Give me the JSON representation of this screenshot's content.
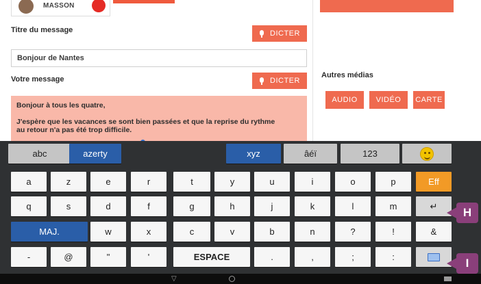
{
  "app": {
    "user_name": "MASSON",
    "title_label": "Titre du message",
    "dictate_label": "DICTER",
    "title_value": "Bonjour de Nantes",
    "message_label": "Votre message",
    "message_lines": [
      "Bonjour à tous les quatre,",
      "J'espère que les vacances se sont bien passées et que la reprise du  rythme\nau retour n'a pas été trop difficile."
    ],
    "right_top_bar": "",
    "media_title": "Autres médias",
    "media_buttons": [
      "AUDIO",
      "VIDÉO",
      "CARTE"
    ]
  },
  "keyboard": {
    "mode_row": [
      "abc",
      "azerty",
      "xyz",
      "âéï",
      "123"
    ],
    "row1": [
      "a",
      "z",
      "e",
      "r",
      "t",
      "y",
      "u",
      "i",
      "o",
      "p",
      "Eff"
    ],
    "row2": [
      "q",
      "s",
      "d",
      "f",
      "g",
      "h",
      "j",
      "k",
      "l",
      "m",
      "↵"
    ],
    "row3": [
      "MAJ.",
      "w",
      "x",
      "c",
      "v",
      "b",
      "n",
      "?",
      "!",
      "&"
    ],
    "row4": [
      "-",
      "@",
      "\"",
      "'",
      "ESPACE",
      ".",
      ",",
      ";",
      ":"
    ]
  },
  "callouts": {
    "enter_marker": "H",
    "keyboard_marker": "I"
  },
  "icons": {
    "mic": "microphone-icon",
    "emoji": "smiley-icon",
    "hide_keyboard": "keyboard-icon",
    "nav_back": "triangle-back-icon",
    "nav_home": "circle-home-icon"
  },
  "colors": {
    "accent": "#ef6a4f",
    "keyboard_bg": "#2f3133",
    "key_blue": "#2a5ea8",
    "key_orange": "#f29a26",
    "marker": "#8a3f7a"
  }
}
